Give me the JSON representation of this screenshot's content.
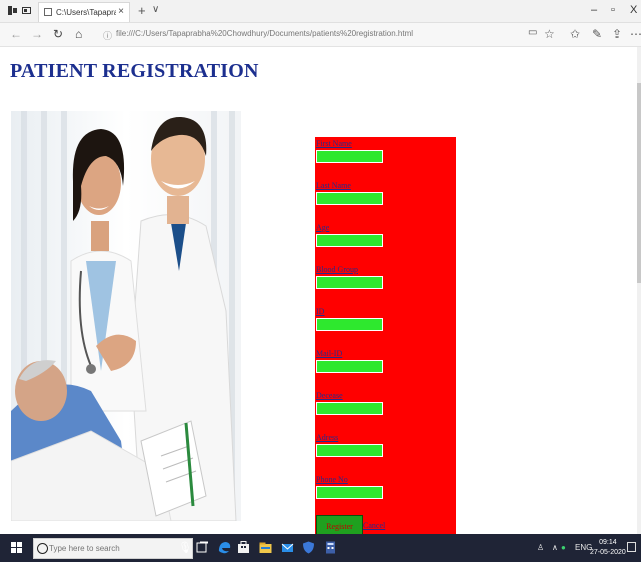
{
  "browser": {
    "tab_title": "C:\\Users\\Tapaprabha Ch",
    "url": "file:///C:/Users/Tapaprabha%20Chowdhury/Documents/patients%20registration.html",
    "win_min": "–",
    "win_max": "▫",
    "win_close": "X",
    "new_tab": "+",
    "tab_menu": "∨"
  },
  "page": {
    "title": "PATIENT REGISTRATION"
  },
  "form": {
    "fields": [
      {
        "label": "First Name"
      },
      {
        "label": "Last Name"
      },
      {
        "label": "Age"
      },
      {
        "label": "Blood Group"
      },
      {
        "label": "ID"
      },
      {
        "label": "Mail-ID"
      },
      {
        "label": "Decease"
      },
      {
        "label": "Adress"
      },
      {
        "label": "Phone No"
      }
    ],
    "register_label": "Register",
    "cancel_label": "Cancel"
  },
  "taskbar": {
    "search_placeholder": "Type here to search",
    "lang": "ENG",
    "time": "09:14",
    "date": "27-05-2020"
  },
  "colors": {
    "title": "#1c2f8f",
    "panel": "#ff0000",
    "input": "#2ee82e",
    "button": "#1fa01f"
  }
}
